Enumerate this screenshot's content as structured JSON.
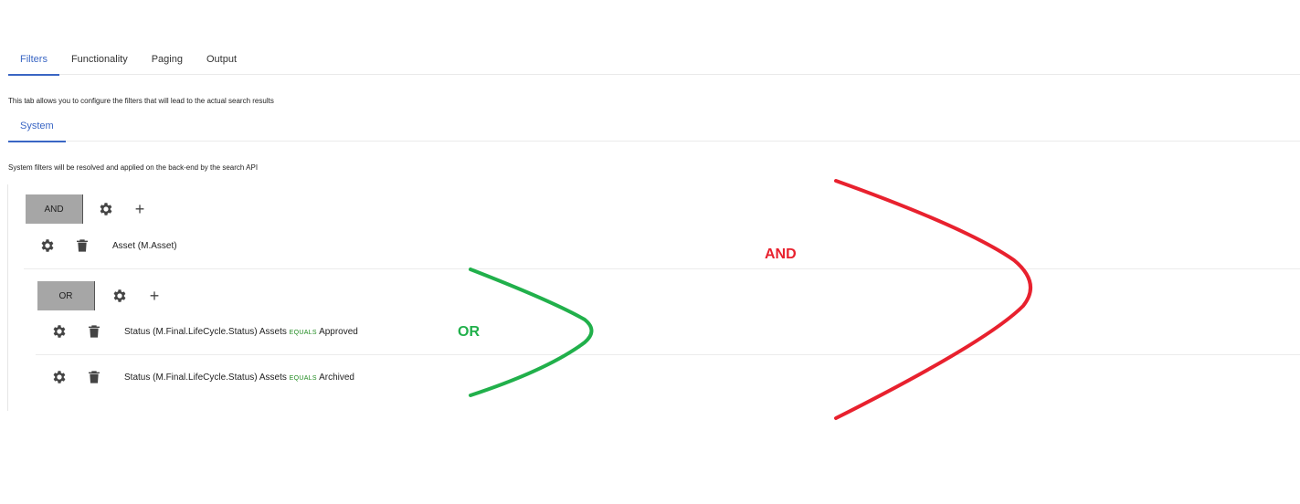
{
  "tabs": [
    {
      "label": "Filters",
      "active": true
    },
    {
      "label": "Functionality",
      "active": false
    },
    {
      "label": "Paging",
      "active": false
    },
    {
      "label": "Output",
      "active": false
    }
  ],
  "filters_description": "This tab allows you to configure the filters that will lead to the actual search results",
  "subtabs": [
    {
      "label": "System",
      "active": true
    }
  ],
  "system_description": "System filters will be resolved and applied on the back-end by the search API",
  "root_group": {
    "operator": "AND",
    "rules": [
      {
        "field": "Asset (M.Asset)"
      }
    ],
    "nested_group": {
      "operator": "OR",
      "rules": [
        {
          "field": "Status (M.Final.LifeCycle.Status) Assets",
          "comparator": "EQUALS",
          "value": "Approved"
        },
        {
          "field": "Status (M.Final.LifeCycle.Status) Assets",
          "comparator": "EQUALS",
          "value": "Archived"
        }
      ]
    }
  },
  "annotations": {
    "or_label": "OR",
    "or_color": "#21b04b",
    "and_label": "AND",
    "and_color": "#e8212e"
  },
  "icons": {
    "settings": "gear-icon",
    "delete": "trash-icon",
    "add": "plus-icon"
  },
  "colors": {
    "accent": "#3a66c4",
    "operator_bg": "#a6a6a6",
    "equals": "#1f8a1f"
  }
}
